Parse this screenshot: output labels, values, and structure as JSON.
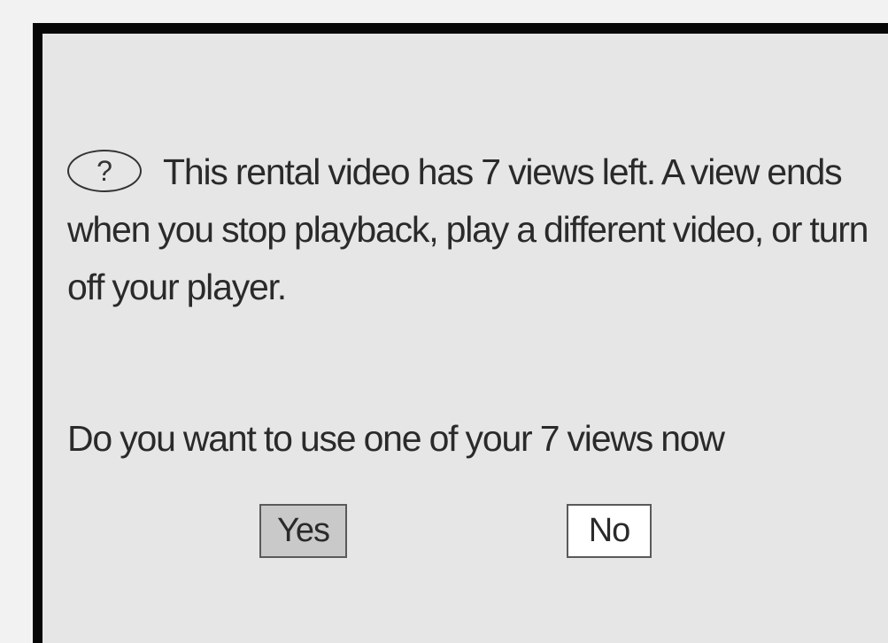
{
  "dialog": {
    "message": "This rental video has 7 views left. A view ends when you stop playback, play a different video, or turn off your player.",
    "question": "Do you want to use one of your 7 views now",
    "help_icon_glyph": "?",
    "help_icon": "question-circle-icon",
    "buttons": {
      "yes_label": "Yes",
      "no_label": "No",
      "focused": "Yes"
    }
  }
}
